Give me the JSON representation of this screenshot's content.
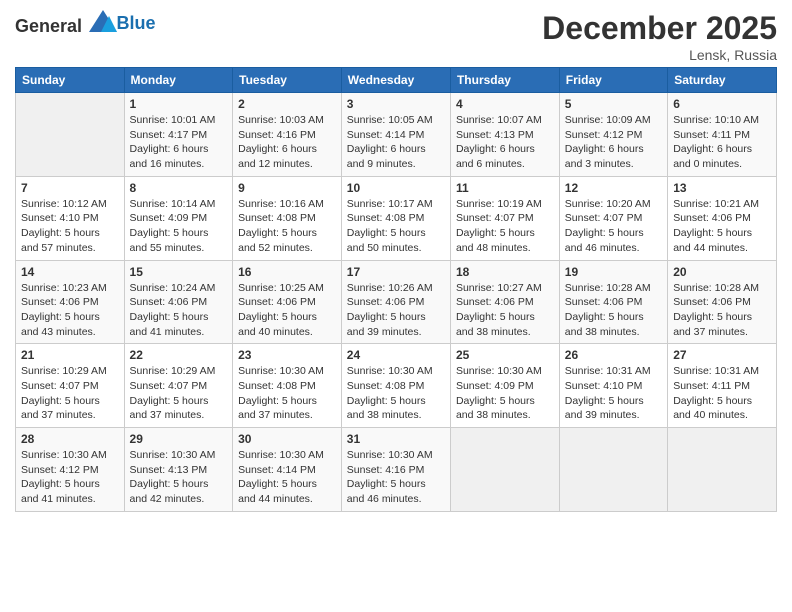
{
  "header": {
    "logo_general": "General",
    "logo_blue": "Blue",
    "title": "December 2025",
    "location": "Lensk, Russia"
  },
  "days_of_week": [
    "Sunday",
    "Monday",
    "Tuesday",
    "Wednesday",
    "Thursday",
    "Friday",
    "Saturday"
  ],
  "weeks": [
    [
      {
        "day": "",
        "sunrise": "",
        "sunset": "",
        "daylight": ""
      },
      {
        "day": "1",
        "sunrise": "Sunrise: 10:01 AM",
        "sunset": "Sunset: 4:17 PM",
        "daylight": "Daylight: 6 hours and 16 minutes."
      },
      {
        "day": "2",
        "sunrise": "Sunrise: 10:03 AM",
        "sunset": "Sunset: 4:16 PM",
        "daylight": "Daylight: 6 hours and 12 minutes."
      },
      {
        "day": "3",
        "sunrise": "Sunrise: 10:05 AM",
        "sunset": "Sunset: 4:14 PM",
        "daylight": "Daylight: 6 hours and 9 minutes."
      },
      {
        "day": "4",
        "sunrise": "Sunrise: 10:07 AM",
        "sunset": "Sunset: 4:13 PM",
        "daylight": "Daylight: 6 hours and 6 minutes."
      },
      {
        "day": "5",
        "sunrise": "Sunrise: 10:09 AM",
        "sunset": "Sunset: 4:12 PM",
        "daylight": "Daylight: 6 hours and 3 minutes."
      },
      {
        "day": "6",
        "sunrise": "Sunrise: 10:10 AM",
        "sunset": "Sunset: 4:11 PM",
        "daylight": "Daylight: 6 hours and 0 minutes."
      }
    ],
    [
      {
        "day": "7",
        "sunrise": "Sunrise: 10:12 AM",
        "sunset": "Sunset: 4:10 PM",
        "daylight": "Daylight: 5 hours and 57 minutes."
      },
      {
        "day": "8",
        "sunrise": "Sunrise: 10:14 AM",
        "sunset": "Sunset: 4:09 PM",
        "daylight": "Daylight: 5 hours and 55 minutes."
      },
      {
        "day": "9",
        "sunrise": "Sunrise: 10:16 AM",
        "sunset": "Sunset: 4:08 PM",
        "daylight": "Daylight: 5 hours and 52 minutes."
      },
      {
        "day": "10",
        "sunrise": "Sunrise: 10:17 AM",
        "sunset": "Sunset: 4:08 PM",
        "daylight": "Daylight: 5 hours and 50 minutes."
      },
      {
        "day": "11",
        "sunrise": "Sunrise: 10:19 AM",
        "sunset": "Sunset: 4:07 PM",
        "daylight": "Daylight: 5 hours and 48 minutes."
      },
      {
        "day": "12",
        "sunrise": "Sunrise: 10:20 AM",
        "sunset": "Sunset: 4:07 PM",
        "daylight": "Daylight: 5 hours and 46 minutes."
      },
      {
        "day": "13",
        "sunrise": "Sunrise: 10:21 AM",
        "sunset": "Sunset: 4:06 PM",
        "daylight": "Daylight: 5 hours and 44 minutes."
      }
    ],
    [
      {
        "day": "14",
        "sunrise": "Sunrise: 10:23 AM",
        "sunset": "Sunset: 4:06 PM",
        "daylight": "Daylight: 5 hours and 43 minutes."
      },
      {
        "day": "15",
        "sunrise": "Sunrise: 10:24 AM",
        "sunset": "Sunset: 4:06 PM",
        "daylight": "Daylight: 5 hours and 41 minutes."
      },
      {
        "day": "16",
        "sunrise": "Sunrise: 10:25 AM",
        "sunset": "Sunset: 4:06 PM",
        "daylight": "Daylight: 5 hours and 40 minutes."
      },
      {
        "day": "17",
        "sunrise": "Sunrise: 10:26 AM",
        "sunset": "Sunset: 4:06 PM",
        "daylight": "Daylight: 5 hours and 39 minutes."
      },
      {
        "day": "18",
        "sunrise": "Sunrise: 10:27 AM",
        "sunset": "Sunset: 4:06 PM",
        "daylight": "Daylight: 5 hours and 38 minutes."
      },
      {
        "day": "19",
        "sunrise": "Sunrise: 10:28 AM",
        "sunset": "Sunset: 4:06 PM",
        "daylight": "Daylight: 5 hours and 38 minutes."
      },
      {
        "day": "20",
        "sunrise": "Sunrise: 10:28 AM",
        "sunset": "Sunset: 4:06 PM",
        "daylight": "Daylight: 5 hours and 37 minutes."
      }
    ],
    [
      {
        "day": "21",
        "sunrise": "Sunrise: 10:29 AM",
        "sunset": "Sunset: 4:07 PM",
        "daylight": "Daylight: 5 hours and 37 minutes."
      },
      {
        "day": "22",
        "sunrise": "Sunrise: 10:29 AM",
        "sunset": "Sunset: 4:07 PM",
        "daylight": "Daylight: 5 hours and 37 minutes."
      },
      {
        "day": "23",
        "sunrise": "Sunrise: 10:30 AM",
        "sunset": "Sunset: 4:08 PM",
        "daylight": "Daylight: 5 hours and 37 minutes."
      },
      {
        "day": "24",
        "sunrise": "Sunrise: 10:30 AM",
        "sunset": "Sunset: 4:08 PM",
        "daylight": "Daylight: 5 hours and 38 minutes."
      },
      {
        "day": "25",
        "sunrise": "Sunrise: 10:30 AM",
        "sunset": "Sunset: 4:09 PM",
        "daylight": "Daylight: 5 hours and 38 minutes."
      },
      {
        "day": "26",
        "sunrise": "Sunrise: 10:31 AM",
        "sunset": "Sunset: 4:10 PM",
        "daylight": "Daylight: 5 hours and 39 minutes."
      },
      {
        "day": "27",
        "sunrise": "Sunrise: 10:31 AM",
        "sunset": "Sunset: 4:11 PM",
        "daylight": "Daylight: 5 hours and 40 minutes."
      }
    ],
    [
      {
        "day": "28",
        "sunrise": "Sunrise: 10:30 AM",
        "sunset": "Sunset: 4:12 PM",
        "daylight": "Daylight: 5 hours and 41 minutes."
      },
      {
        "day": "29",
        "sunrise": "Sunrise: 10:30 AM",
        "sunset": "Sunset: 4:13 PM",
        "daylight": "Daylight: 5 hours and 42 minutes."
      },
      {
        "day": "30",
        "sunrise": "Sunrise: 10:30 AM",
        "sunset": "Sunset: 4:14 PM",
        "daylight": "Daylight: 5 hours and 44 minutes."
      },
      {
        "day": "31",
        "sunrise": "Sunrise: 10:30 AM",
        "sunset": "Sunset: 4:16 PM",
        "daylight": "Daylight: 5 hours and 46 minutes."
      },
      {
        "day": "",
        "sunrise": "",
        "sunset": "",
        "daylight": ""
      },
      {
        "day": "",
        "sunrise": "",
        "sunset": "",
        "daylight": ""
      },
      {
        "day": "",
        "sunrise": "",
        "sunset": "",
        "daylight": ""
      }
    ]
  ]
}
